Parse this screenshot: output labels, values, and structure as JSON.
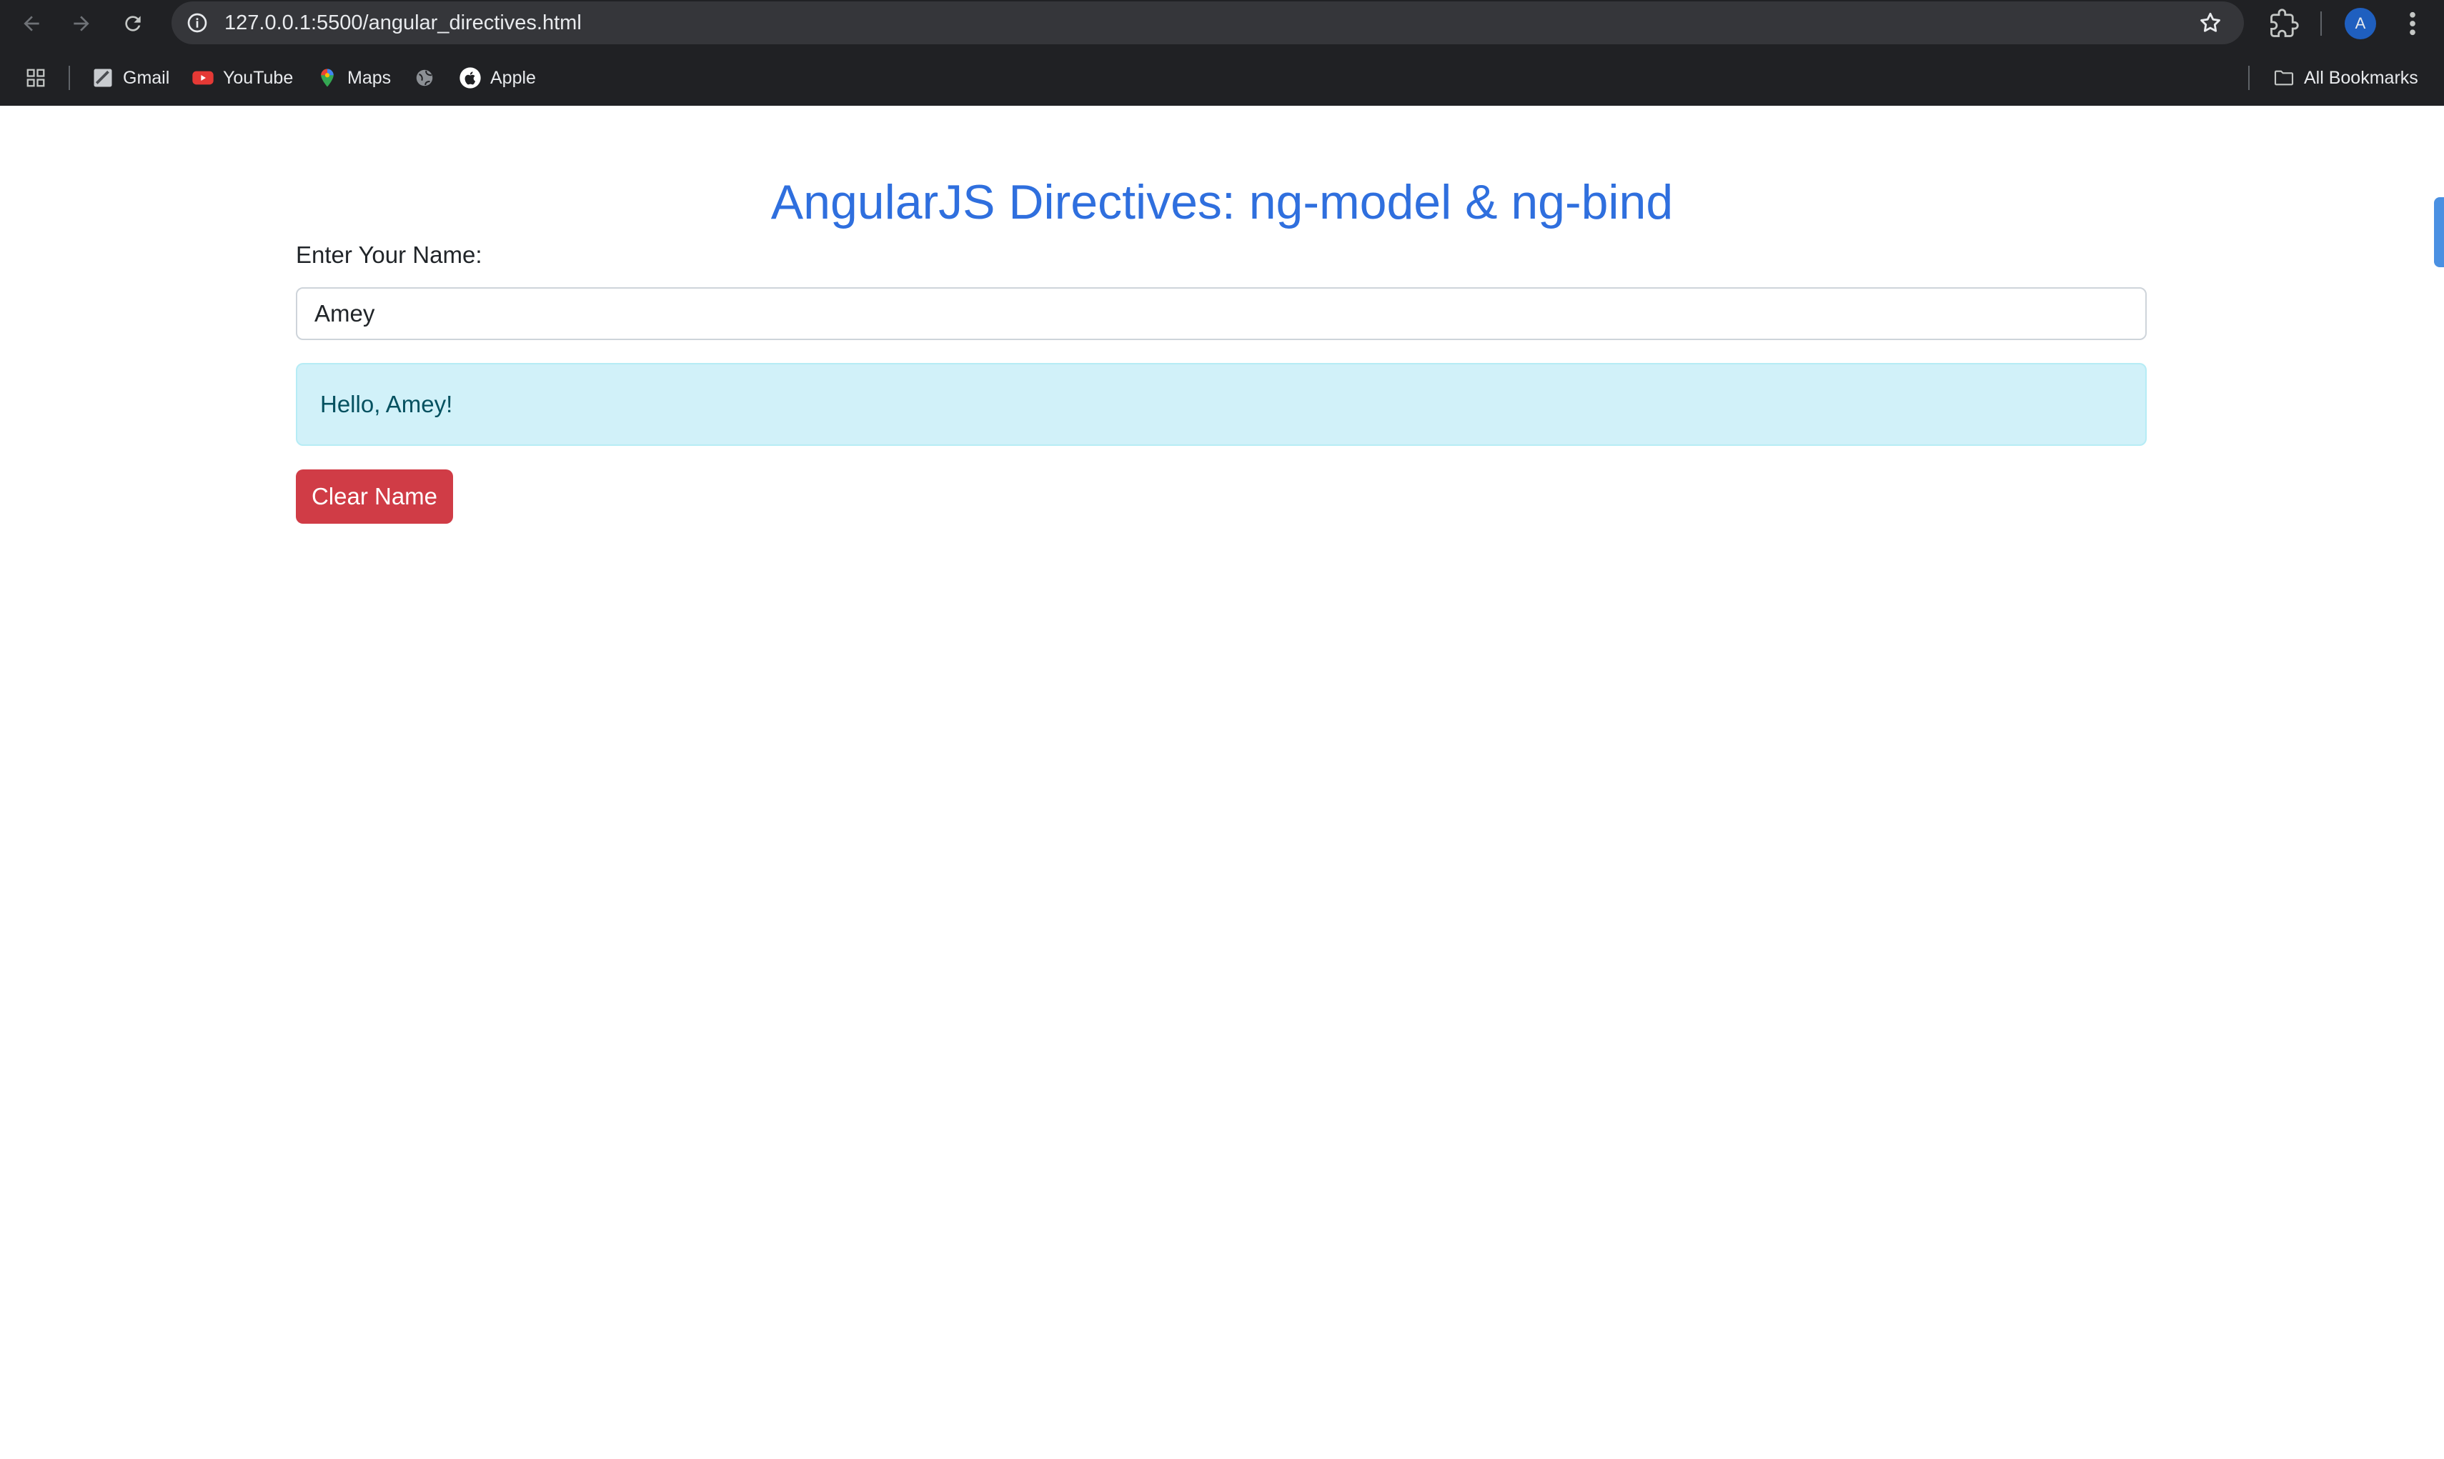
{
  "browser": {
    "url": "127.0.0.1:5500/angular_directives.html",
    "profile_initial": "A",
    "bookmarks": [
      {
        "label": "Gmail",
        "icon": "gmail-icon"
      },
      {
        "label": "YouTube",
        "icon": "youtube-icon"
      },
      {
        "label": "Maps",
        "icon": "maps-icon"
      },
      {
        "label": "",
        "icon": "globe-icon"
      },
      {
        "label": "Apple",
        "icon": "apple-icon"
      }
    ],
    "all_bookmarks_label": "All Bookmarks"
  },
  "page": {
    "heading": "AngularJS Directives: ng-model & ng-bind",
    "input_label": "Enter Your Name:",
    "name_value": "Amey",
    "greeting": "Hello, Amey!",
    "clear_button_label": "Clear Name"
  },
  "colors": {
    "heading": "#2f6fde",
    "alert_bg": "#d1f1f9",
    "button_bg": "#d03c46",
    "chrome_bg": "#202124"
  }
}
